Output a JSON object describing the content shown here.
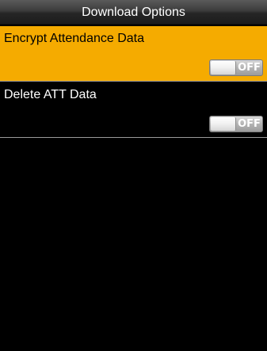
{
  "header": {
    "title": "Download Options"
  },
  "options": [
    {
      "label": "Encrypt Attendance Data",
      "toggle_text": "OFF",
      "selected": true
    },
    {
      "label": "Delete ATT Data",
      "toggle_text": "OFF",
      "selected": false
    }
  ],
  "colors": {
    "highlight": "#f5ab00",
    "background": "#000000"
  }
}
